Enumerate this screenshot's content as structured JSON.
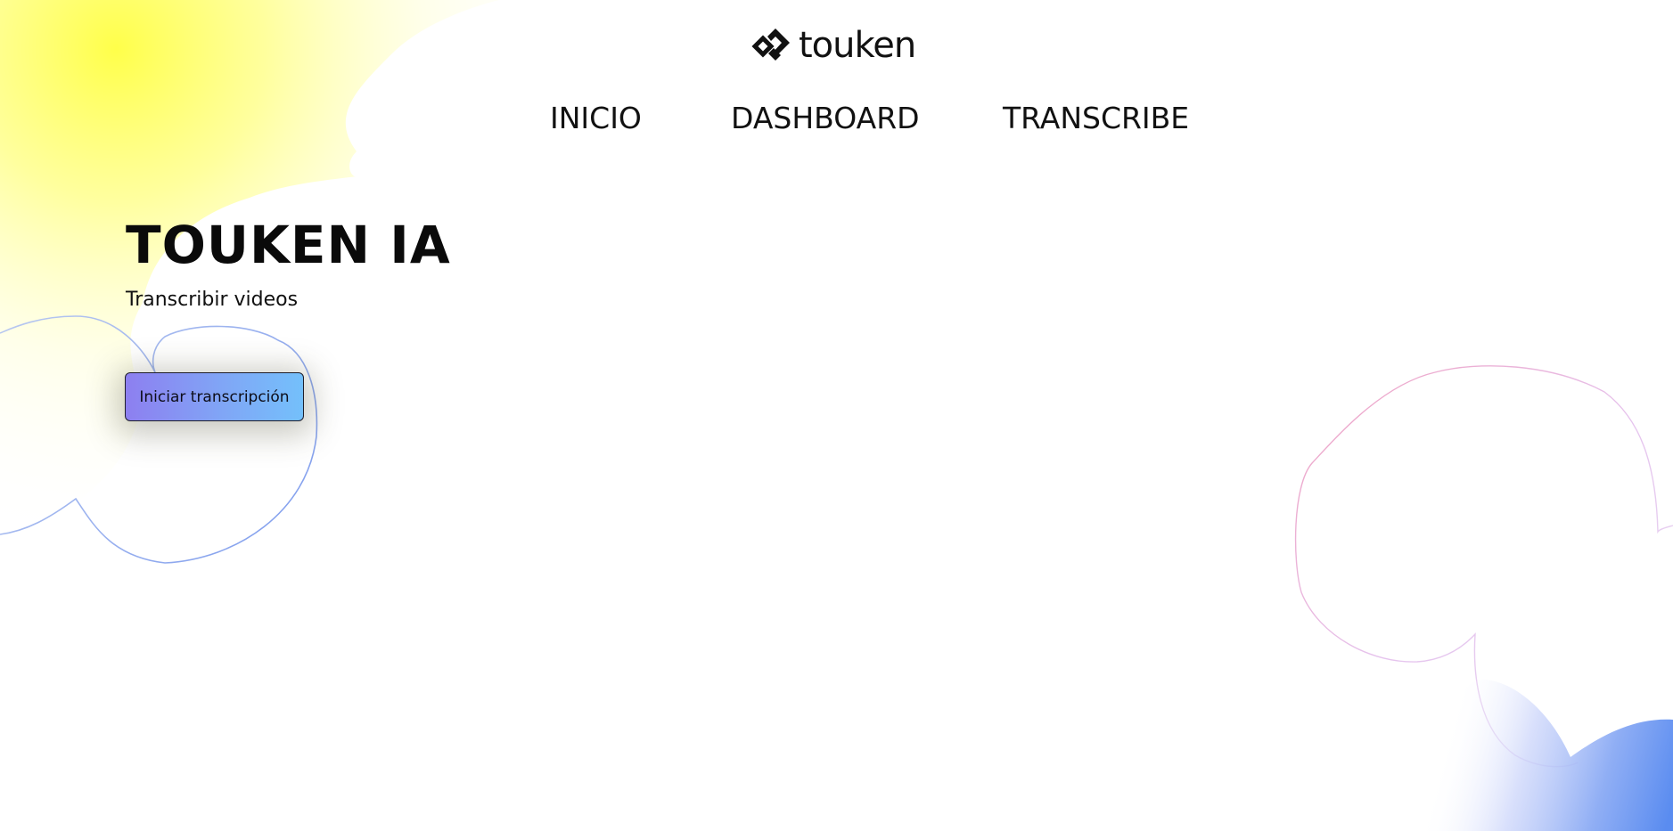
{
  "brand": {
    "logo_text": "touken",
    "logo_icon": "touken-diamond-logo-icon"
  },
  "nav": {
    "items": [
      {
        "label": "INICIO"
      },
      {
        "label": "DASHBOARD"
      },
      {
        "label": "TRANSCRIBE"
      }
    ]
  },
  "hero": {
    "title": "TOUKEN IA",
    "subtitle": "Transcribir videos",
    "cta_label": "Iniciar transcripción"
  },
  "colors": {
    "blob_yellow": "#ffff5a",
    "blob_blue": "#5a8cf0",
    "outline_blue": "#90aaf0",
    "outline_pink": "#f0a0c8",
    "cta_gradient_start": "#8d7ff0",
    "cta_gradient_end": "#74c0fb"
  }
}
